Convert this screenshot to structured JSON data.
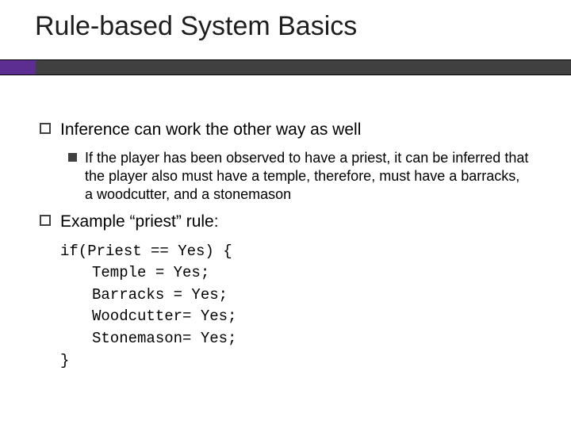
{
  "title": "Rule-based System Basics",
  "bullets": {
    "b1": "Inference can work the other way as well",
    "b1sub": "If the player has been observed to have a priest, it can be inferred that the player also must have a temple, therefore, must have a barracks, a woodcutter, and a stonemason",
    "b2": "Example “priest” rule:"
  },
  "code": {
    "l1": "if(Priest == Yes) {",
    "l2": "Temple = Yes;",
    "l3": "Barracks = Yes;",
    "l4": "Woodcutter= Yes;",
    "l5": "Stonemason= Yes;",
    "l6": "}"
  }
}
